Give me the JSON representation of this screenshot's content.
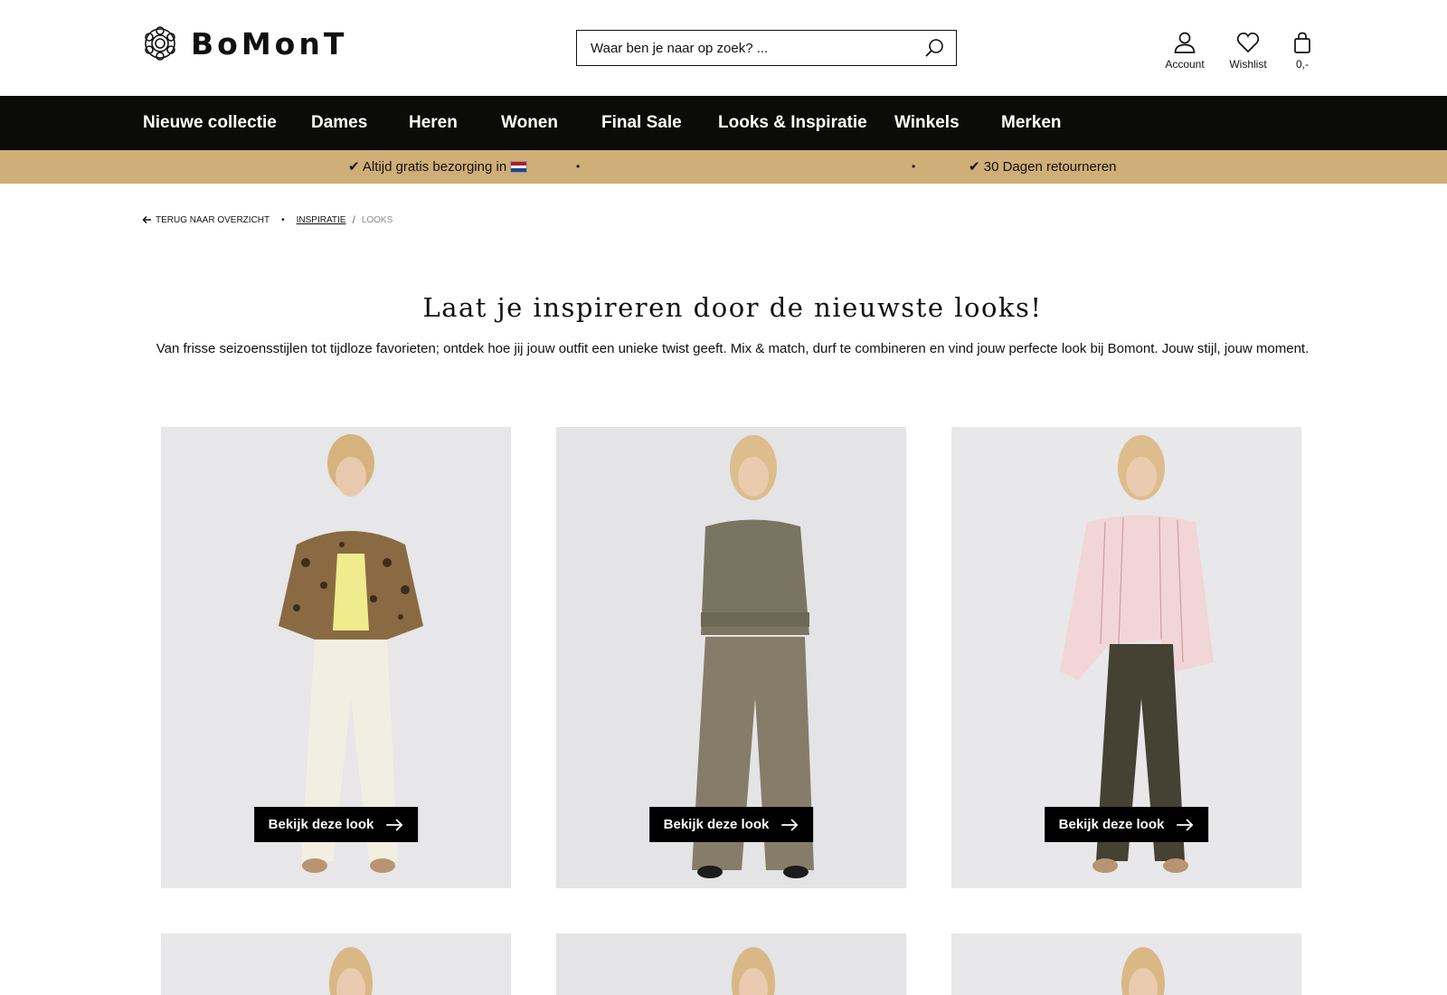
{
  "header": {
    "logo_text": "BoMonT",
    "search_placeholder": "Waar ben je naar op zoek? ...",
    "account_label": "Account",
    "wishlist_label": "Wishlist",
    "cart_label": "0,-"
  },
  "nav": {
    "items": [
      "Nieuwe collectie",
      "Dames",
      "Heren",
      "Wonen",
      "Final Sale",
      "Looks & Inspiratie",
      "Winkels",
      "Merken"
    ]
  },
  "usp": {
    "item1": "✔ Altijd gratis bezorging in",
    "item2": "✔ 30 Dagen retourneren",
    "dot": "•"
  },
  "breadcrumb": {
    "back": "Terug naar overzicht",
    "sep": "•",
    "link": "Inspiratie",
    "slash": "/",
    "current": "Looks"
  },
  "intro": {
    "title": "Laat je inspireren door de nieuwste looks!",
    "text": "Van frisse seizoensstijlen tot tijdloze favorieten; ontdek hoe jij jouw outfit een unieke twist geeft. Mix & match, durf te combineren en vind jouw perfecte look bij Bomont. Jouw stijl, jouw moment."
  },
  "looks": {
    "button_label": "Bekijk deze look"
  },
  "colors": {
    "nav_bg": "#0b0c09",
    "usp_bg": "#cfae77",
    "card_bg": "#e6e5e7"
  }
}
